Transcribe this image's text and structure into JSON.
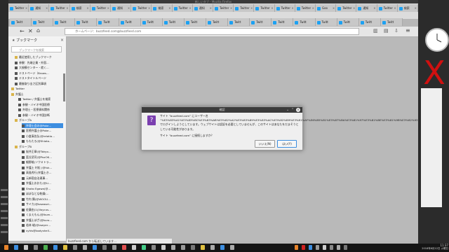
{
  "window": {
    "title": "新しいタブ - Mozilla Firefox"
  },
  "tabs": [
    "Twitter",
    "通知",
    "Twitter",
    "検索",
    "Twitter",
    "通知",
    "Twitter",
    "検索",
    "Twitter",
    "通知",
    "Twitter",
    "Twitter",
    "Twitter",
    "Twitter",
    "Twitter",
    "Goo",
    "Twitter",
    "通知",
    "Twitter",
    "検索"
  ],
  "tabs_row2": [
    "Twitt",
    "Twitt",
    "Twitt",
    "Twitt",
    "Twitt",
    "Twitt",
    "Twitt",
    "Twitt",
    "Twitt",
    "Twitt",
    "Twitt",
    "Twitt",
    "Twitt",
    "Twitt",
    "Twitt",
    "Twitt",
    "Twitt",
    "Twitt"
  ],
  "url": {
    "text": "ホームページ：buzzfeed.com@buzzfeed.com"
  },
  "sidebar": {
    "title": "ブックマーク",
    "search_placeholder": "ブックマークを検索",
    "items": [
      {
        "label": "最近使用したブックマーク",
        "folder": true,
        "indent": 1
      },
      {
        "label": "参観：先端企業・外国…",
        "folder": false,
        "indent": 1
      },
      {
        "label": "大規模センター・就く…",
        "folder": false,
        "indent": 1
      },
      {
        "label": "テストページ（Brows…",
        "folder": false,
        "indent": 1
      },
      {
        "label": "テストタイトルページ",
        "folder": false,
        "indent": 1
      },
      {
        "label": "最後取り出さ区別事項",
        "folder": false,
        "indent": 1
      },
      {
        "label": "Twitter",
        "folder": true,
        "indent": 0
      },
      {
        "label": "弁護士",
        "folder": true,
        "indent": 0
      },
      {
        "label": "Twitter / 弁護士を検索",
        "folder": false,
        "indent": 2
      },
      {
        "label": "参観・バイオ中国医療",
        "folder": false,
        "indent": 2
      },
      {
        "label": "弁理士・医療資料関係",
        "folder": false,
        "indent": 2
      },
      {
        "label": "参観・バイオ中国診断",
        "folder": false,
        "indent": 2
      },
      {
        "label": "グループA",
        "folder": true,
        "indent": 1
      },
      {
        "label": "弁理士会の@Poke…",
        "folder": false,
        "indent": 3,
        "selected": true
      },
      {
        "label": "医療弁護士@Poke…",
        "folder": false,
        "indent": 3
      },
      {
        "label": "小倉真佐弘(@relatio…",
        "folder": false,
        "indent": 3
      },
      {
        "label": "ももたろ(@Shiota…",
        "folder": false,
        "indent": 3
      },
      {
        "label": "グループB",
        "folder": true,
        "indent": 1
      },
      {
        "label": "桜井正章(@Tokyo…",
        "folder": false,
        "indent": 3
      },
      {
        "label": "藍谷武司(@PozOK…",
        "folder": false,
        "indent": 3
      },
      {
        "label": "細野雄(ソクミトラ…",
        "folder": false,
        "indent": 3
      },
      {
        "label": "弁護士 村松 (@fuk…",
        "folder": false,
        "indent": 3
      },
      {
        "label": "高島秀行(弁護士き…",
        "folder": false,
        "indent": 3
      },
      {
        "label": "元新宿自治連事…",
        "folder": false,
        "indent": 3
      },
      {
        "label": "弁護士おおた(@Li…",
        "folder": false,
        "indent": 3
      },
      {
        "label": "Shoko Egawa(@…",
        "folder": false,
        "indent": 3
      },
      {
        "label": "ほぼなとな乾燥(…",
        "folder": false,
        "indent": 3
      },
      {
        "label": "竹内 舞(@WOOU…",
        "folder": false,
        "indent": 3
      },
      {
        "label": "サイカ(@kawasei…",
        "folder": false,
        "indent": 3
      },
      {
        "label": "佐藤由(1)/Voycus…",
        "folder": false,
        "indent": 3
      },
      {
        "label": "くまえもん(@ikum…",
        "folder": false,
        "indent": 3
      },
      {
        "label": "弁護士ぼざ(@kuro…",
        "folder": false,
        "indent": 3
      },
      {
        "label": "若林 峻(@lawyer…",
        "folder": false,
        "indent": 3
      },
      {
        "label": "vyhis@bodyshell…",
        "folder": false,
        "indent": 3
      }
    ]
  },
  "status": "buzzfeed.com から転送しています...",
  "dialog": {
    "title": "確認",
    "message": "サイト “buzzfeed.com” にユーザー名 “%E3%83%A1%E3%83%BC%E3%83%AB%E3%82%A2%E3%83%89%E3%83%AC%E3%82%B9%E3%81%AF%E6%B5%81%E5%87%BA%E3%81%97%E3%81%BE%E3%81%9B%E3%82%93” でログインしようとしています。ウェブサイトは認証を必要としていませんが、このサイトはあなたをだまそうとしている可能性があります。",
    "question": "サイト “buzzfeed.com” に接続しますか？",
    "no_label": "いいえ(N)",
    "yes_label": "はい(Y)"
  },
  "clock": {
    "time": "11:37",
    "date": "2018年6月12日 火曜日"
  },
  "desktop": {
    "redx_label": "X"
  }
}
